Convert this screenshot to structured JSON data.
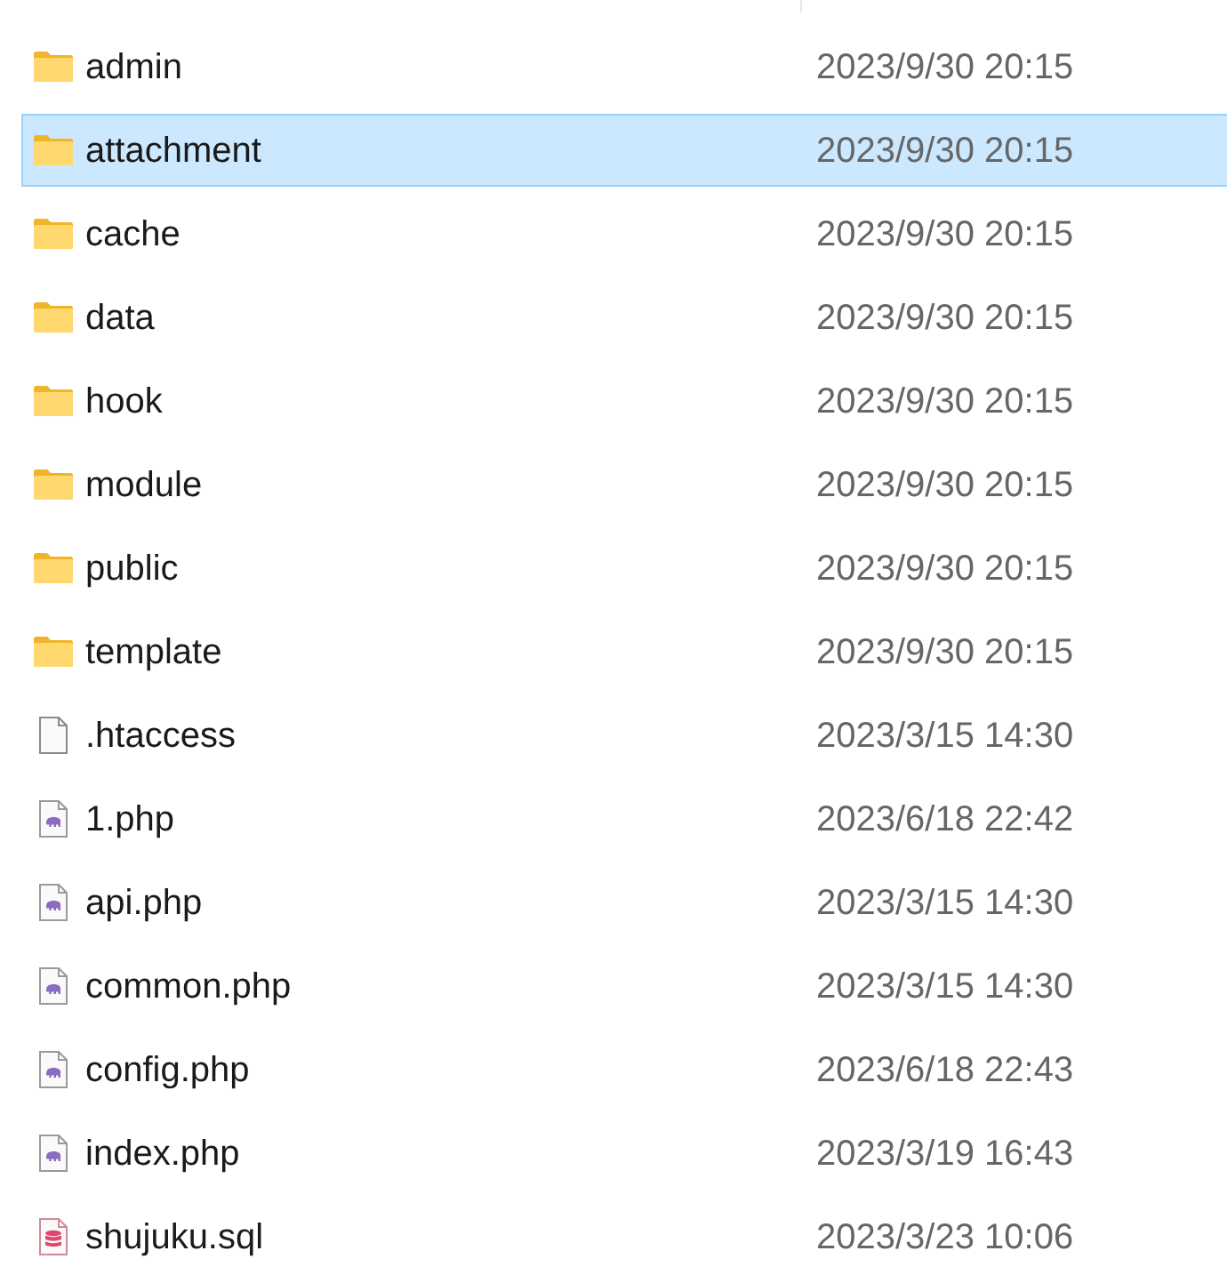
{
  "files": [
    {
      "name": "admin",
      "modified": "2023/9/30 20:15",
      "kind": "folder",
      "selected": false
    },
    {
      "name": "attachment",
      "modified": "2023/9/30 20:15",
      "kind": "folder",
      "selected": true
    },
    {
      "name": "cache",
      "modified": "2023/9/30 20:15",
      "kind": "folder",
      "selected": false
    },
    {
      "name": "data",
      "modified": "2023/9/30 20:15",
      "kind": "folder",
      "selected": false
    },
    {
      "name": "hook",
      "modified": "2023/9/30 20:15",
      "kind": "folder",
      "selected": false
    },
    {
      "name": "module",
      "modified": "2023/9/30 20:15",
      "kind": "folder",
      "selected": false
    },
    {
      "name": "public",
      "modified": "2023/9/30 20:15",
      "kind": "folder",
      "selected": false
    },
    {
      "name": "template",
      "modified": "2023/9/30 20:15",
      "kind": "folder",
      "selected": false
    },
    {
      "name": ".htaccess",
      "modified": "2023/3/15 14:30",
      "kind": "file",
      "selected": false
    },
    {
      "name": "1.php",
      "modified": "2023/6/18 22:42",
      "kind": "php",
      "selected": false
    },
    {
      "name": "api.php",
      "modified": "2023/3/15 14:30",
      "kind": "php",
      "selected": false
    },
    {
      "name": "common.php",
      "modified": "2023/3/15 14:30",
      "kind": "php",
      "selected": false
    },
    {
      "name": "config.php",
      "modified": "2023/6/18 22:43",
      "kind": "php",
      "selected": false
    },
    {
      "name": "index.php",
      "modified": "2023/3/19 16:43",
      "kind": "php",
      "selected": false
    },
    {
      "name": "shujuku.sql",
      "modified": "2023/3/23 10:06",
      "kind": "sql",
      "selected": false
    }
  ]
}
